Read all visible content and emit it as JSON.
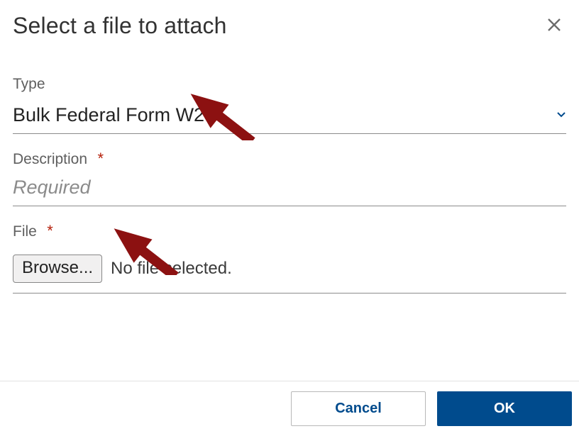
{
  "dialog": {
    "title": "Select a file to attach"
  },
  "fields": {
    "type": {
      "label": "Type",
      "value": "Bulk Federal Form W2"
    },
    "description": {
      "label": "Description",
      "placeholder": "Required"
    },
    "file": {
      "label": "File",
      "browse_label": "Browse...",
      "status_text": "No file selected."
    }
  },
  "footer": {
    "cancel_label": "Cancel",
    "ok_label": "OK"
  }
}
